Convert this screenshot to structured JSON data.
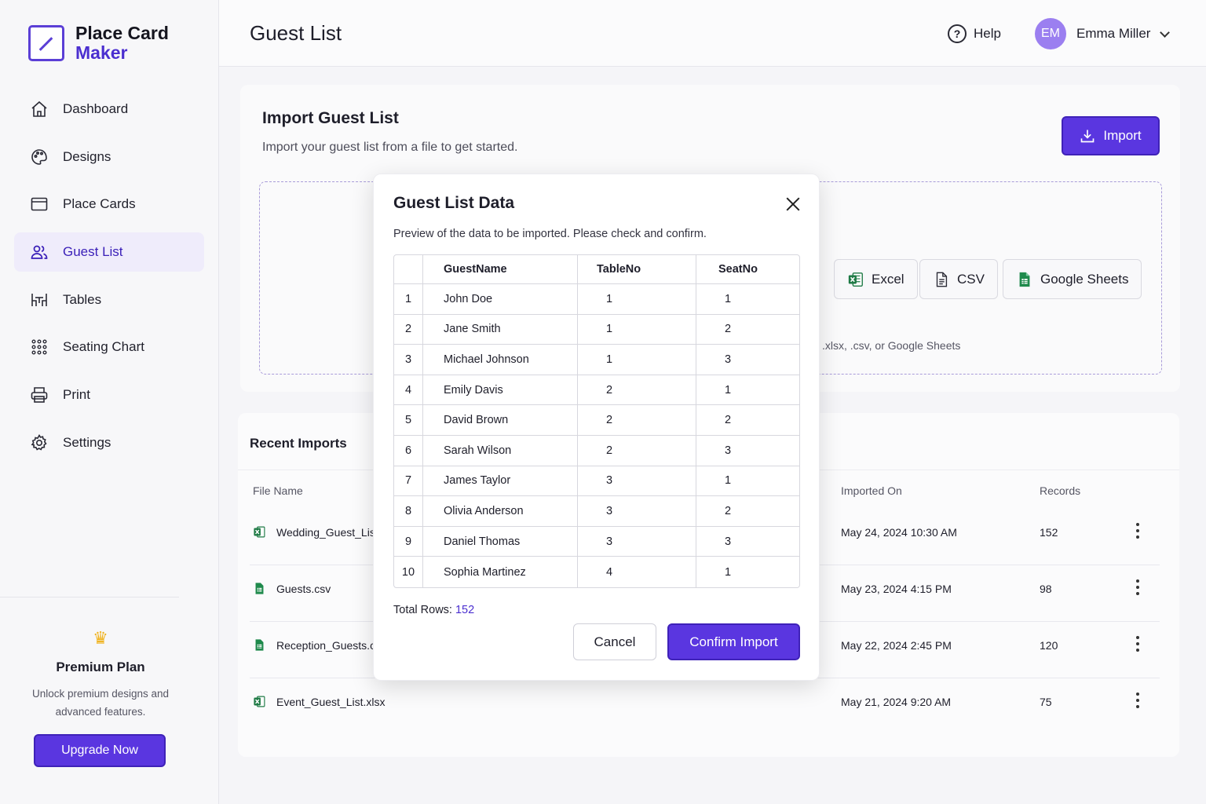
{
  "app": {
    "name_line1": "Place Card",
    "name_line2": "Maker"
  },
  "sidebar": {
    "items": [
      {
        "label": "Dashboard",
        "icon": "home-icon"
      },
      {
        "label": "Designs",
        "icon": "palette-icon"
      },
      {
        "label": "Place Cards",
        "icon": "card-icon"
      },
      {
        "label": "Guest List",
        "icon": "users-icon",
        "active": true
      },
      {
        "label": "Tables",
        "icon": "table-chairs-icon"
      },
      {
        "label": "Seating Chart",
        "icon": "grid-dots-icon"
      },
      {
        "label": "Print",
        "icon": "printer-icon"
      },
      {
        "label": "Settings",
        "icon": "gear-icon"
      }
    ],
    "premium": {
      "title": "Premium Plan",
      "description": "Unlock premium designs and advanced features.",
      "button": "Upgrade Now"
    }
  },
  "header": {
    "title": "Guest List",
    "help": "Help",
    "user_initials": "EM",
    "user_name": "Emma Miller"
  },
  "import_card": {
    "title": "Import Guest List",
    "subtitle": "Import your guest list from a file to get started.",
    "import_button": "Import",
    "formats": [
      "Excel",
      "CSV",
      "Google Sheets"
    ],
    "hint": ".xlsx, .csv, or Google Sheets"
  },
  "recent": {
    "title": "Recent Imports",
    "columns": {
      "file_name": "File Name",
      "imported_on": "Imported On",
      "records": "Records"
    },
    "rows": [
      {
        "file": "Wedding_Guest_Lis",
        "date": "May 24, 2024 10:30 AM",
        "records": "152",
        "type": "excel"
      },
      {
        "file": "Guests.csv",
        "date": "May 23, 2024 4:15 PM",
        "records": "98",
        "type": "sheet"
      },
      {
        "file": "Reception_Guests.c",
        "date": "May 22, 2024 2:45 PM",
        "records": "120",
        "type": "sheet"
      },
      {
        "file": "Event_Guest_List.xlsx",
        "date": "May 21, 2024 9:20 AM",
        "records": "75",
        "type": "excel"
      }
    ]
  },
  "modal": {
    "title": "Guest List Data",
    "description": "Preview of the data to be imported. Please check and confirm.",
    "columns": [
      "GuestName",
      "TableNo",
      "SeatNo"
    ],
    "rows": [
      [
        "1",
        "John Doe",
        "1",
        "1"
      ],
      [
        "2",
        "Jane Smith",
        "1",
        "2"
      ],
      [
        "3",
        "Michael Johnson",
        "1",
        "3"
      ],
      [
        "4",
        "Emily Davis",
        "2",
        "1"
      ],
      [
        "5",
        "David Brown",
        "2",
        "2"
      ],
      [
        "6",
        "Sarah Wilson",
        "2",
        "3"
      ],
      [
        "7",
        "James Taylor",
        "3",
        "1"
      ],
      [
        "8",
        "Olivia Anderson",
        "3",
        "2"
      ],
      [
        "9",
        "Daniel Thomas",
        "3",
        "3"
      ],
      [
        "10",
        "Sophia Martinez",
        "4",
        "1"
      ]
    ],
    "total_label": "Total Rows:",
    "total_value": "152",
    "cancel": "Cancel",
    "confirm": "Confirm Import"
  },
  "colors": {
    "accent": "#5a36e0",
    "accent_dark": "#3f22b8",
    "active_bg": "#efecfb",
    "excel_green": "#1e7a45",
    "sheets_green": "#1f8a4c",
    "crown": "#f0b21b"
  }
}
